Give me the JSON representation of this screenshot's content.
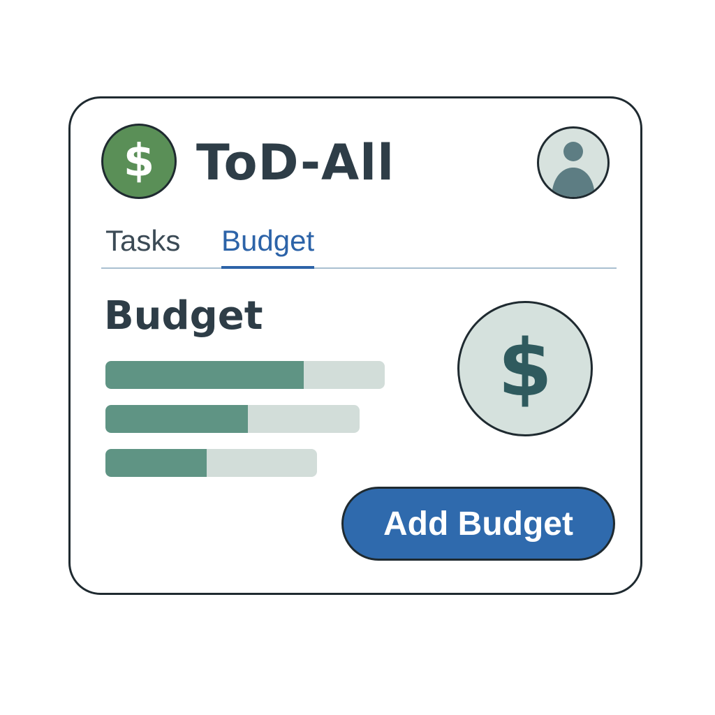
{
  "app": {
    "title": "ToD-All",
    "logo_symbol": "$",
    "logo_icon": "dollar-icon",
    "avatar_icon": "user-avatar-icon"
  },
  "tabs": [
    {
      "label": "Tasks",
      "active": false
    },
    {
      "label": "Budget",
      "active": true
    }
  ],
  "main": {
    "section_title": "Budget",
    "big_symbol": "$",
    "big_icon": "dollar-icon",
    "bars": [
      {
        "fill_fraction": 0.71
      },
      {
        "fill_fraction": 0.56
      },
      {
        "fill_fraction": 0.48
      }
    ],
    "add_button_label": "Add Budget"
  },
  "colors": {
    "accent": "#2f6aad",
    "logo_green": "#5a8f57",
    "bar_fill": "#5f9484",
    "bar_track": "#d2ddd9",
    "text_dark": "#2e3d47"
  }
}
